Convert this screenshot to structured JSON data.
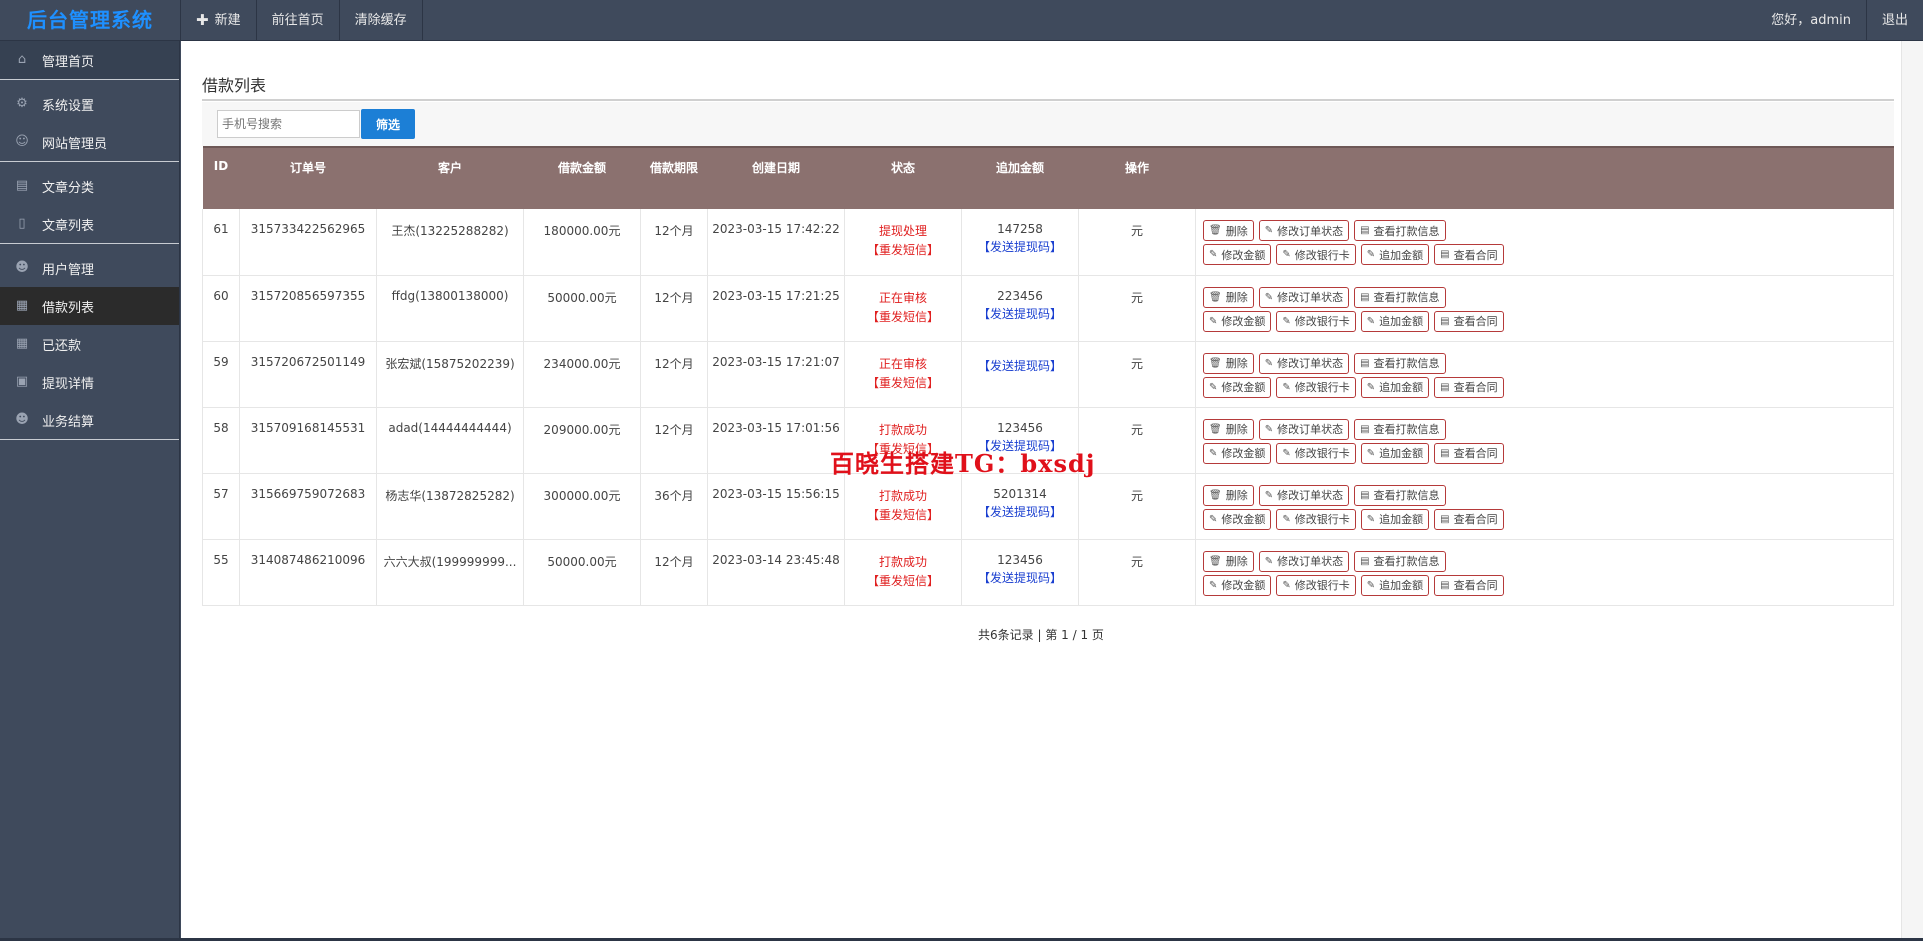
{
  "app": {
    "title": "后台管理系统"
  },
  "topnav": [
    {
      "label": "新建",
      "icon": "plus-icon"
    },
    {
      "label": "前往首页"
    },
    {
      "label": "清除缓存"
    }
  ],
  "user": {
    "greeting": "您好，admin",
    "logout": "退出"
  },
  "sidebar": {
    "items": [
      {
        "label": "管理首页",
        "icon": "home-icon"
      },
      {
        "label": "系统设置",
        "icon": "gear-icon"
      },
      {
        "label": "网站管理员",
        "icon": "user-icon"
      },
      {
        "label": "文章分类",
        "icon": "book-icon"
      },
      {
        "label": "文章列表",
        "icon": "document-icon"
      },
      {
        "label": "用户管理",
        "icon": "users-icon"
      },
      {
        "label": "借款列表",
        "icon": "grid-icon"
      },
      {
        "label": "已还款",
        "icon": "grid-icon"
      },
      {
        "label": "提现详情",
        "icon": "inbox-icon"
      },
      {
        "label": "业务结算",
        "icon": "users-icon"
      }
    ],
    "active": "借款列表"
  },
  "page": {
    "title": "借款列表"
  },
  "search": {
    "placeholder": "手机号搜索",
    "button": "筛选"
  },
  "table": {
    "headers": [
      "ID",
      "订单号",
      "客户",
      "借款金额",
      "借款期限",
      "创建日期",
      "状态",
      "追加金额",
      "操作"
    ],
    "rows": [
      {
        "id": "61",
        "order": "315733422562965",
        "customer": "王杰(13225288282)",
        "amount": "180000.00元",
        "term": "12个月",
        "date": "2023-03-15 17:42:22",
        "status": "提现处理",
        "resend": "【重发短信】",
        "extra": "147258",
        "send_code": "【发送提现码】",
        "unit": "元"
      },
      {
        "id": "60",
        "order": "315720856597355",
        "customer": "ffdg(13800138000)",
        "amount": "50000.00元",
        "term": "12个月",
        "date": "2023-03-15 17:21:25",
        "status": "正在审核",
        "resend": "【重发短信】",
        "extra": "223456",
        "send_code": "【发送提现码】",
        "unit": "元"
      },
      {
        "id": "59",
        "order": "315720672501149",
        "customer": "张宏斌(15875202239)",
        "amount": "234000.00元",
        "term": "12个月",
        "date": "2023-03-15 17:21:07",
        "status": "正在审核",
        "resend": "【重发短信】",
        "extra": "",
        "send_code": "【发送提现码】",
        "unit": "元"
      },
      {
        "id": "58",
        "order": "315709168145531",
        "customer": "adad(14444444444)",
        "amount": "209000.00元",
        "term": "12个月",
        "date": "2023-03-15 17:01:56",
        "status": "打款成功",
        "resend": "【重发短信】",
        "extra": "123456",
        "send_code": "【发送提现码】",
        "unit": "元"
      },
      {
        "id": "57",
        "order": "315669759072683",
        "customer": "杨志华(13872825282)",
        "amount": "300000.00元",
        "term": "36个月",
        "date": "2023-03-15 15:56:15",
        "status": "打款成功",
        "resend": "【重发短信】",
        "extra": "5201314",
        "send_code": "【发送提现码】",
        "unit": "元"
      },
      {
        "id": "55",
        "order": "314087486210096",
        "customer": "六六大叔(199999999...",
        "amount": "50000.00元",
        "term": "12个月",
        "date": "2023-03-14 23:45:48",
        "status": "打款成功",
        "resend": "【重发短信】",
        "extra": "123456",
        "send_code": "【发送提现码】",
        "unit": "元"
      }
    ],
    "ops_row1": [
      {
        "label": "删除",
        "icon": "trash-icon"
      },
      {
        "label": "修改订单状态",
        "icon": "edit-icon"
      },
      {
        "label": "查看打款信息",
        "icon": "list-icon"
      }
    ],
    "ops_row2": [
      {
        "label": "修改金额",
        "icon": "edit-icon"
      },
      {
        "label": "修改银行卡",
        "icon": "edit-icon"
      },
      {
        "label": "追加金额",
        "icon": "edit-icon"
      },
      {
        "label": "查看合同",
        "icon": "list-icon"
      }
    ]
  },
  "pager": {
    "text": "共6条记录 | 第 1 / 1 页"
  },
  "watermark": {
    "text": "百晓生搭建TG：bxsdj"
  }
}
